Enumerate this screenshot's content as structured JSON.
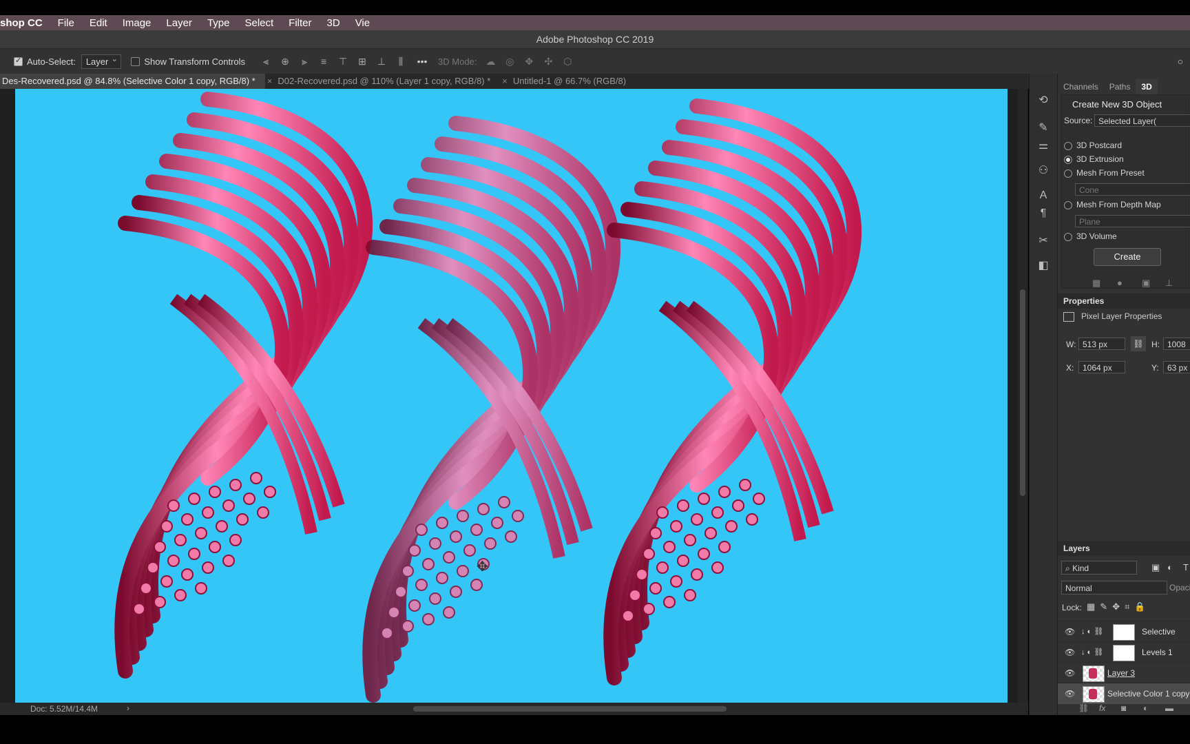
{
  "menu": {
    "app": "shop CC",
    "items": [
      "File",
      "Edit",
      "Image",
      "Layer",
      "Type",
      "Select",
      "Filter",
      "3D",
      "Vie"
    ]
  },
  "window_title": "Adobe Photoshop CC 2019",
  "options_bar": {
    "auto_select_label": "Auto-Select:",
    "auto_select_value": "Layer",
    "transform_label": "Show Transform Controls",
    "more": "•••",
    "mode_3d": "3D Mode:"
  },
  "tabs": [
    {
      "label": "Des-Recovered.psd @ 84.8% (Selective Color 1 copy, RGB/8) *",
      "active": true
    },
    {
      "label": "D02-Recovered.psd @ 110% (Layer 1 copy, RGB/8) *",
      "active": false
    },
    {
      "label": "Untitled-1 @ 66.7% (RGB/8)",
      "active": false
    }
  ],
  "status": {
    "doc": "Doc: 5.52M/14.4M",
    "arrow": "›"
  },
  "panel_3d": {
    "tabs": [
      "Channels",
      "Paths",
      "3D"
    ],
    "heading": "Create New 3D Object",
    "source_label": "Source:",
    "source_value": "Selected Layer(",
    "options": [
      {
        "label": "3D Postcard",
        "checked": false
      },
      {
        "label": "3D Extrusion",
        "checked": true
      },
      {
        "label": "Mesh From Preset",
        "checked": false
      },
      {
        "label": "Mesh From Depth Map",
        "checked": false
      },
      {
        "label": "3D Volume",
        "checked": false
      }
    ],
    "preset_value": "Cone",
    "depth_value": "Plane",
    "create": "Create"
  },
  "properties": {
    "title": "Properties",
    "subtitle": "Pixel Layer Properties",
    "w_label": "W:",
    "w_value": "513 px",
    "h_label": "H:",
    "h_value": "1008",
    "x_label": "X:",
    "x_value": "1064 px",
    "y_label": "Y:",
    "y_value": "63 px"
  },
  "layers_panel": {
    "title": "Layers",
    "filter": "Kind",
    "blend": "Normal",
    "opacity_label": "Opaci",
    "lock_label": "Lock:",
    "layers": [
      {
        "name": "Selective",
        "type": "adjust",
        "selected": false
      },
      {
        "name": "Levels 1",
        "type": "adjust",
        "selected": false
      },
      {
        "name": "Layer 3",
        "type": "pixel",
        "selected": false
      },
      {
        "name": "Selective Color 1 copy",
        "type": "pixel",
        "selected": true
      }
    ]
  },
  "colors": {
    "canvas_bg": "#35c6f8",
    "tube_pink": "#e0306a"
  }
}
